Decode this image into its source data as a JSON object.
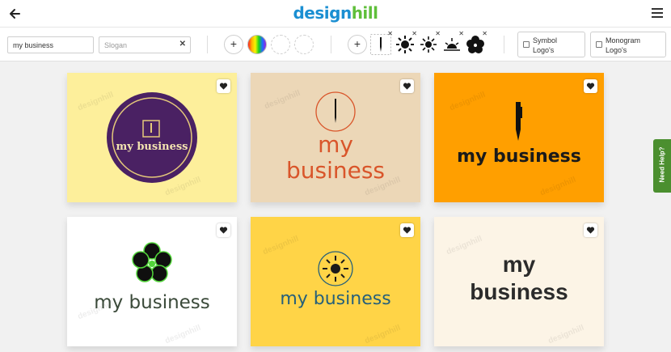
{
  "header": {
    "brand_part1": "design",
    "brand_part2": "hill",
    "back_icon": "arrow-left-icon",
    "menu_icon": "hamburger-menu-icon"
  },
  "toolbar": {
    "name_value": "my business",
    "slogan_placeholder": "Slogan",
    "clear_icon": "close-icon",
    "add_color_label": "+",
    "add_icon_label": "+",
    "icons": [
      "pen-icon",
      "sun-icon",
      "sun-rays-icon",
      "sunrise-icon",
      "flower-icon"
    ],
    "symbol_label_line1": "Symbol",
    "symbol_label_line2": "Logo's",
    "monogram_label_line1": "Monogram",
    "monogram_label_line2": "Logo's"
  },
  "cards": [
    {
      "bg": "#fdef9b",
      "name": "my business",
      "style": "purple-circle-seal"
    },
    {
      "bg": "#ecd7b7",
      "line1": "my",
      "line2": "business",
      "style": "pen-in-circle",
      "text_color": "#d9552a"
    },
    {
      "bg": "#ff9f00",
      "name": "my business",
      "style": "pen-bold",
      "text_color": "#1a1a1a"
    },
    {
      "bg": "#ffffff",
      "name": "my business",
      "style": "green-flower",
      "text_color": "#3b4a3a"
    },
    {
      "bg": "#ffd447",
      "name": "my business",
      "style": "sun-emblem",
      "text_color": "#26607a"
    },
    {
      "bg": "#fcf4e6",
      "line1": "my",
      "line2": "business",
      "style": "bold-stack",
      "text_color": "#2b2b2b"
    }
  ],
  "watermark": "designhill",
  "help": {
    "label": "Need Help?"
  }
}
